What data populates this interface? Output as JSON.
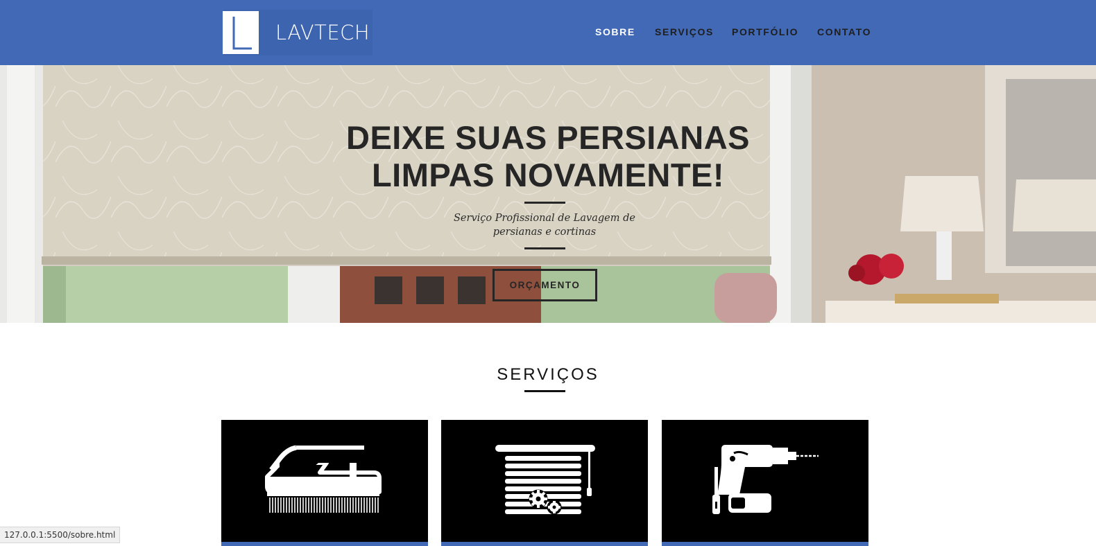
{
  "header": {
    "brand": "LAVTECH",
    "nav": [
      "SOBRE",
      "SERVIÇOS",
      "PORTFÓLIO",
      "CONTATO"
    ],
    "active_nav": "SOBRE"
  },
  "hero": {
    "title_line1": "DEIXE SUAS PERSIANAS",
    "title_line2": "LIMPAS NOVAMENTE!",
    "subtitle_line1": "Serviço Profissional de Lavagem de",
    "subtitle_line2": "persianas e cortinas",
    "cta_label": "ORÇAMENTO"
  },
  "services": {
    "title": "SERVIÇOS",
    "cards": [
      {
        "icon": "cleaning-brush-icon"
      },
      {
        "icon": "blinds-gears-icon"
      },
      {
        "icon": "power-drill-icon"
      }
    ]
  },
  "statusbar": {
    "url": "127.0.0.1:5500/sobre.html"
  },
  "colors": {
    "header_bg": "#4169b6",
    "accent": "#4169b6",
    "text_dark": "#262626"
  }
}
